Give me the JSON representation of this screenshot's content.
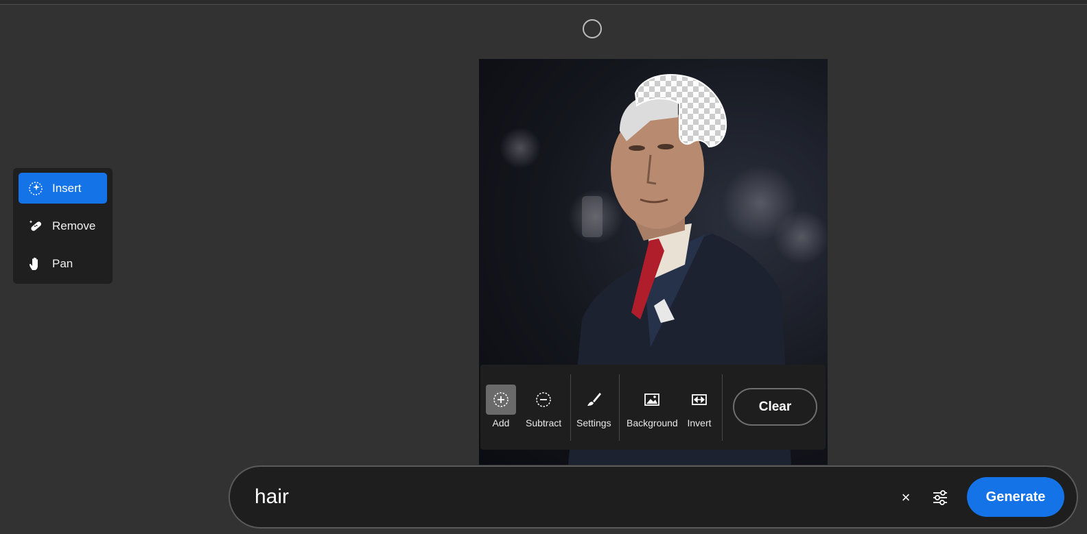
{
  "tools": {
    "items": [
      {
        "label": "Insert",
        "icon": "insert-sparkle-icon",
        "active": true
      },
      {
        "label": "Remove",
        "icon": "remove-bandage-icon",
        "active": false
      },
      {
        "label": "Pan",
        "icon": "hand-icon",
        "active": false
      }
    ]
  },
  "selection_toolbar": {
    "add_label": "Add",
    "subtract_label": "Subtract",
    "settings_label": "Settings",
    "background_label": "Background",
    "invert_label": "Invert",
    "clear_label": "Clear"
  },
  "prompt": {
    "value": "hair",
    "clear_icon": "×",
    "generate_label": "Generate"
  },
  "colors": {
    "accent": "#1473e6",
    "background": "#323232",
    "panel": "#1e1e1e"
  }
}
